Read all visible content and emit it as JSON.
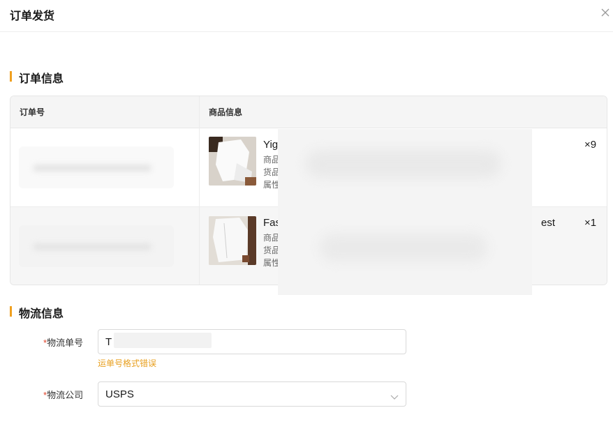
{
  "dialog": {
    "title": "订单发货"
  },
  "sections": {
    "order": "订单信息",
    "logistics": "物流信息"
  },
  "table": {
    "headers": [
      "订单号",
      "商品信息"
    ],
    "rows": [
      {
        "order_no": "",
        "name": "Yig",
        "meta": [
          "商品",
          "货品",
          "属性"
        ],
        "suffix": "",
        "qty": "×9"
      },
      {
        "order_no": "",
        "name": "Fas",
        "meta": [
          "商品",
          "货品",
          "属性"
        ],
        "suffix": "est",
        "qty": "×1"
      }
    ]
  },
  "form": {
    "tracking": {
      "required_mark": "*",
      "label": "物流单号",
      "value": "T",
      "error": "运单号格式错误"
    },
    "company": {
      "required_mark": "*",
      "label": "物流公司",
      "value": "USPS"
    }
  },
  "colors": {
    "accent": "#f0a020",
    "error": "#e8a020",
    "required": "#e0442a"
  },
  "icons": {
    "close": "close-icon",
    "dropdown": "chevron-down-icon"
  }
}
